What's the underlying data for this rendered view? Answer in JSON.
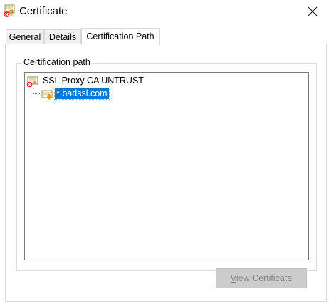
{
  "window": {
    "title": "Certificate",
    "icon": "certificate-error-icon",
    "close_icon": "close-icon"
  },
  "tabs": [
    {
      "label": "General",
      "active": false
    },
    {
      "label": "Details",
      "active": false
    },
    {
      "label": "Certification Path",
      "active": true
    }
  ],
  "certification_path": {
    "group_label_pre": "Certification ",
    "group_label_mnemonic": "p",
    "group_label_post": "ath",
    "tree": [
      {
        "label": "SSL Proxy CA UNTRUST",
        "icon": "certificate-error-icon",
        "selected": false
      },
      {
        "label": "*.badssl.com",
        "icon": "certificate-icon",
        "selected": true
      }
    ]
  },
  "buttons": {
    "view_certificate_mnemonic": "V",
    "view_certificate_rest": "iew Certificate",
    "view_certificate_enabled": false
  },
  "colors": {
    "selection": "#0078d7",
    "disabled_button_bg": "#cccccc",
    "disabled_text": "#838383"
  }
}
